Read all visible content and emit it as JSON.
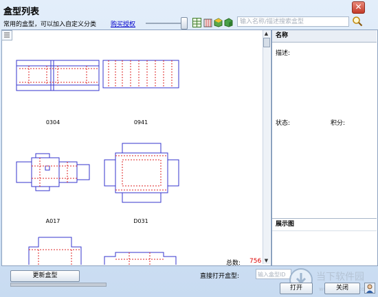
{
  "window": {
    "title": "盒型列表",
    "close_symbol": "✕"
  },
  "header": {
    "subtitle": "常用的盒型，可以加入自定义分类",
    "buy_link": "购买授权",
    "search_placeholder": "输入名称/描述搜索盒型"
  },
  "list": {
    "items": [
      {
        "code": "0304"
      },
      {
        "code": "0941"
      },
      {
        "code": "A017"
      },
      {
        "code": "D031"
      }
    ],
    "scroll_up": "▲",
    "scroll_down": "▼"
  },
  "details": {
    "name_header": "名称",
    "description_label": "描述:",
    "status_label": "状态:",
    "points_label": "积分:",
    "preview_header": "展示图"
  },
  "footer": {
    "total_label": "总数:",
    "total_value": "756",
    "update_button": "更新盒型",
    "direct_open_label": "直接打开盒型:",
    "direct_open_placeholder": "输入盒型ID",
    "open_button": "打开",
    "close_button": "关闭"
  },
  "watermark": {
    "text": "当下软件园",
    "url": "www.downxia.com"
  },
  "colors": {
    "outline": "#3333cc",
    "fold_line": "#dd2222",
    "total": "#dd0000",
    "link": "#0000cc"
  }
}
